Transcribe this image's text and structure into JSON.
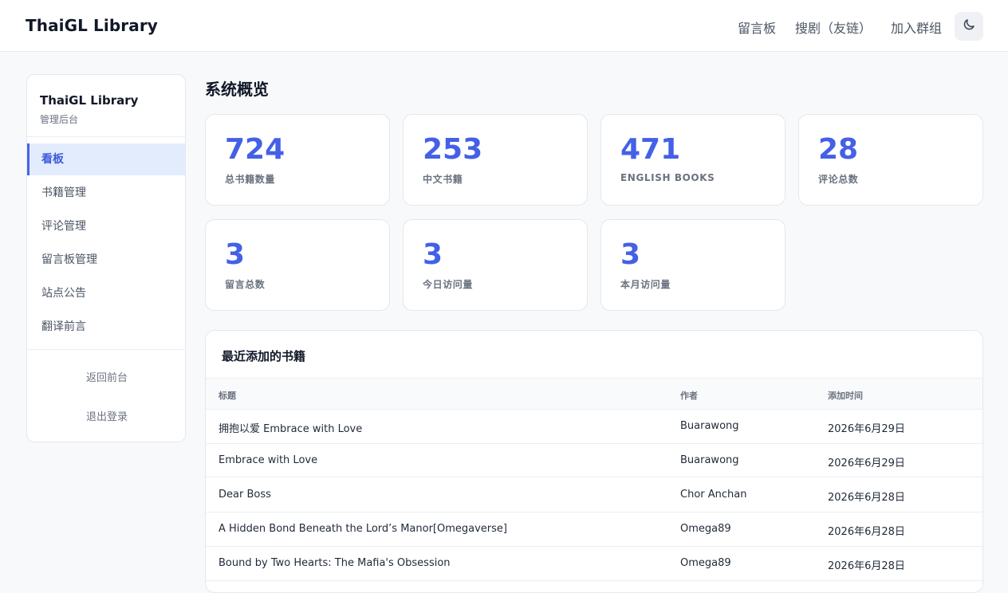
{
  "brand": "ThaiGL Library",
  "topnav": {
    "guestbook": "留言板",
    "search": "搜剧（友链）",
    "join_group": "加入群组"
  },
  "theme_toggle_icon": "moon-icon",
  "sidebar": {
    "title": "ThaiGL Library",
    "subtitle": "管理后台",
    "items": [
      {
        "label": "看板",
        "active": true
      },
      {
        "label": "书籍管理",
        "active": false
      },
      {
        "label": "评论管理",
        "active": false
      },
      {
        "label": "留言板管理",
        "active": false
      },
      {
        "label": "站点公告",
        "active": false
      },
      {
        "label": "翻译前言",
        "active": false
      }
    ],
    "back_label": "返回前台",
    "logout_label": "退出登录"
  },
  "page_title": "系统概览",
  "stats": [
    {
      "value": "724",
      "label": "总书籍数量"
    },
    {
      "value": "253",
      "label": "中文书籍"
    },
    {
      "value": "471",
      "label": "ENGLISH BOOKS"
    },
    {
      "value": "28",
      "label": "评论总数"
    },
    {
      "value": "3",
      "label": "留言总数"
    },
    {
      "value": "3",
      "label": "今日访问量"
    },
    {
      "value": "3",
      "label": "本月访问量"
    }
  ],
  "recent": {
    "title": "最近添加的书籍",
    "columns": {
      "title": "标题",
      "author": "作者",
      "added": "添加时间"
    },
    "rows": [
      {
        "title": "拥抱以爱 Embrace with Love",
        "author": "Buarawong",
        "added": "2026年6月29日"
      },
      {
        "title": "Embrace with Love",
        "author": "Buarawong",
        "added": "2026年6月29日"
      },
      {
        "title": "Dear Boss",
        "author": "Chor Anchan",
        "added": "2026年6月28日"
      },
      {
        "title": "A Hidden Bond Beneath the Lord’s Manor[Omegaverse]",
        "author": "Omega89",
        "added": "2026年6月28日"
      },
      {
        "title": "Bound by Two Hearts: The Mafia's Obsession",
        "author": "Omega89",
        "added": "2026年6月28日"
      }
    ]
  },
  "colors": {
    "accent": "#4460e6",
    "active_bg": "#e3ecfd",
    "page_bg": "#f8f9fb"
  }
}
